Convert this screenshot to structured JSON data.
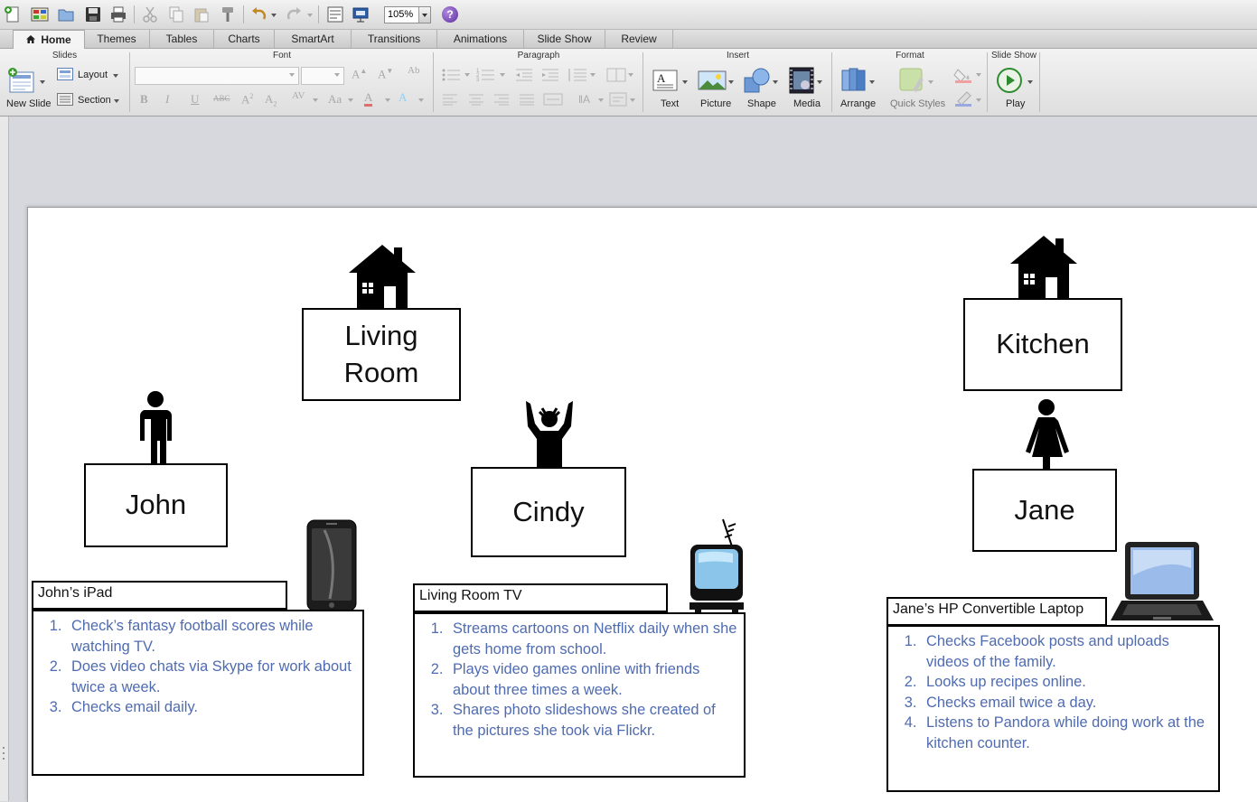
{
  "toolbar": {
    "zoom": "105%"
  },
  "tabs": [
    "Home",
    "Themes",
    "Tables",
    "Charts",
    "SmartArt",
    "Transitions",
    "Animations",
    "Slide Show",
    "Review"
  ],
  "ribbon": {
    "groups": [
      "Slides",
      "Font",
      "Paragraph",
      "Insert",
      "Format",
      "Slide Show"
    ],
    "slides": {
      "new_slide": "New Slide",
      "layout": "Layout",
      "section": "Section"
    },
    "insert": {
      "text": "Text",
      "picture": "Picture",
      "shape": "Shape",
      "media": "Media"
    },
    "format": {
      "arrange": "Arrange",
      "quick_styles": "Quick Styles"
    },
    "slideshow": {
      "play": "Play"
    }
  },
  "slide": {
    "rooms": [
      "Living Room",
      "Kitchen"
    ],
    "people": [
      "John",
      "Cindy",
      "Jane"
    ],
    "devices": [
      {
        "title": "John’s iPad",
        "items": [
          "Check’s fantasy football scores while watching TV.",
          "Does video chats via Skype for work about twice a week.",
          "Checks email daily."
        ]
      },
      {
        "title": "Living Room TV",
        "items": [
          "Streams cartoons on Netflix daily when she gets home from school.",
          "Plays video games online with friends about three times a week.",
          "Shares photo slideshows she created of the pictures she took via Flickr."
        ]
      },
      {
        "title": "Jane’s HP Convertible Laptop",
        "items": [
          "Checks Facebook posts and uploads videos of the family.",
          "Looks up recipes online.",
          "Checks email twice a day.",
          "Listens to Pandora while doing work at the kitchen counter."
        ]
      }
    ]
  }
}
